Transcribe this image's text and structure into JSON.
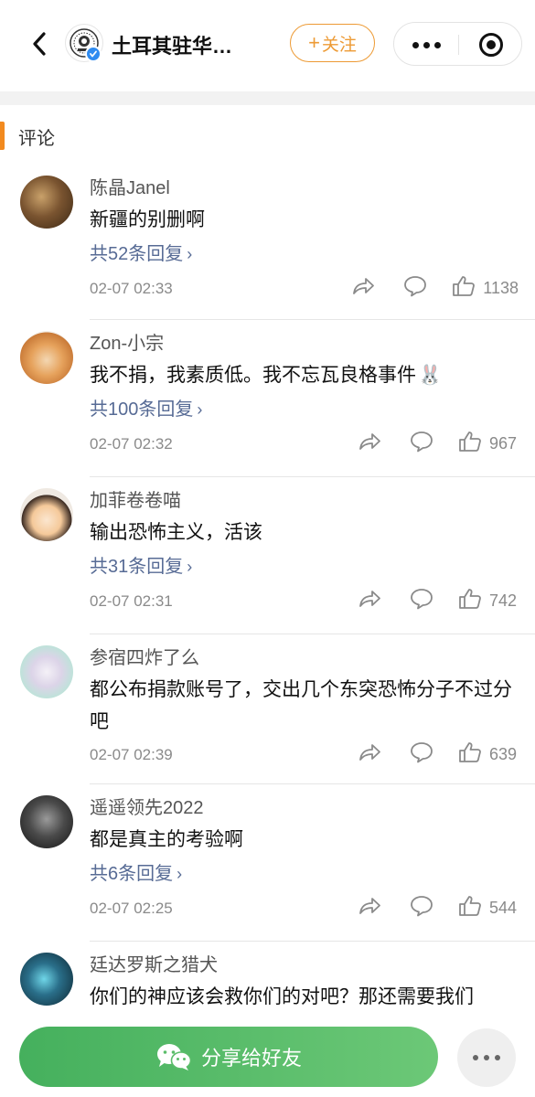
{
  "header": {
    "account_name": "土耳其驻华…",
    "follow_label": "关注",
    "follow_plus": "+",
    "colors": {
      "accent": "#ed9a34",
      "verified": "#2f8bf0"
    }
  },
  "section": {
    "title": "评论",
    "accent_color": "#f28a1f"
  },
  "comments": [
    {
      "name": "陈晶Janel",
      "text": "新疆的别删啊",
      "replies": "共52条回复",
      "time": "02-07 02:33",
      "likes": "1138",
      "emoji": ""
    },
    {
      "name": "Zon-小宗",
      "text": "我不捐，我素质低。我不忘瓦良格事件",
      "replies": "共100条回复",
      "time": "02-07 02:32",
      "likes": "967",
      "emoji": "🐰"
    },
    {
      "name": "加菲卷卷喵",
      "text": "输出恐怖主义，活该",
      "replies": "共31条回复",
      "time": "02-07 02:31",
      "likes": "742",
      "emoji": ""
    },
    {
      "name": "参宿四炸了么",
      "text": "都公布捐款账号了，交出几个东突恐怖分子不过分吧",
      "replies": "",
      "time": "02-07 02:39",
      "likes": "639",
      "emoji": ""
    },
    {
      "name": "遥遥领先2022",
      "text": "都是真主的考验啊",
      "replies": "共6条回复",
      "time": "02-07 02:25",
      "likes": "544",
      "emoji": ""
    },
    {
      "name": "廷达罗斯之猎犬",
      "text": "你们的神应该会救你们的对吧？那还需要我们",
      "replies": "",
      "time": "",
      "likes": "",
      "emoji": ""
    }
  ],
  "bottom": {
    "share_label": "分享给好友",
    "share_color": "#4caf50"
  },
  "icons": {
    "back": "chevron-left-icon",
    "share": "share-arrow-icon",
    "reply": "speech-bubble-icon",
    "like": "thumbs-up-icon",
    "wechat": "wechat-icon",
    "more": "more-dots-icon",
    "close": "close-circle-icon"
  }
}
